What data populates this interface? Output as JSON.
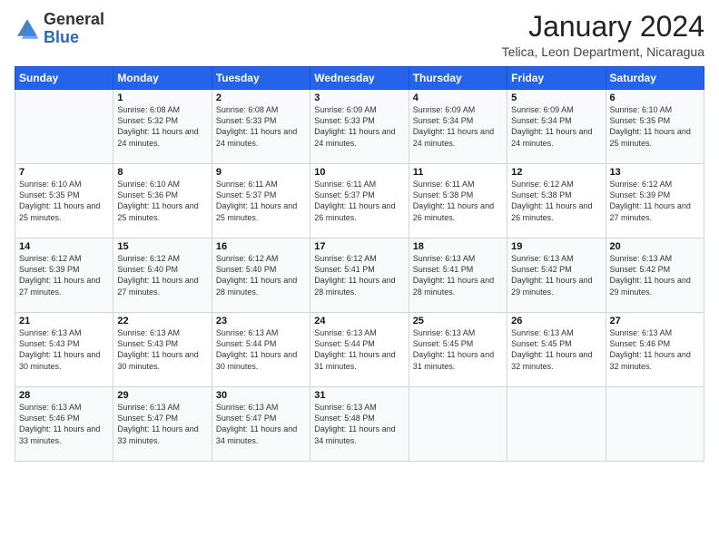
{
  "logo": {
    "general": "General",
    "blue": "Blue"
  },
  "title": "January 2024",
  "location": "Telica, Leon Department, Nicaragua",
  "days_of_week": [
    "Sunday",
    "Monday",
    "Tuesday",
    "Wednesday",
    "Thursday",
    "Friday",
    "Saturday"
  ],
  "weeks": [
    [
      {
        "day": "",
        "sunrise": "",
        "sunset": "",
        "daylight": ""
      },
      {
        "day": "1",
        "sunrise": "Sunrise: 6:08 AM",
        "sunset": "Sunset: 5:32 PM",
        "daylight": "Daylight: 11 hours and 24 minutes."
      },
      {
        "day": "2",
        "sunrise": "Sunrise: 6:08 AM",
        "sunset": "Sunset: 5:33 PM",
        "daylight": "Daylight: 11 hours and 24 minutes."
      },
      {
        "day": "3",
        "sunrise": "Sunrise: 6:09 AM",
        "sunset": "Sunset: 5:33 PM",
        "daylight": "Daylight: 11 hours and 24 minutes."
      },
      {
        "day": "4",
        "sunrise": "Sunrise: 6:09 AM",
        "sunset": "Sunset: 5:34 PM",
        "daylight": "Daylight: 11 hours and 24 minutes."
      },
      {
        "day": "5",
        "sunrise": "Sunrise: 6:09 AM",
        "sunset": "Sunset: 5:34 PM",
        "daylight": "Daylight: 11 hours and 24 minutes."
      },
      {
        "day": "6",
        "sunrise": "Sunrise: 6:10 AM",
        "sunset": "Sunset: 5:35 PM",
        "daylight": "Daylight: 11 hours and 25 minutes."
      }
    ],
    [
      {
        "day": "7",
        "sunrise": "Sunrise: 6:10 AM",
        "sunset": "Sunset: 5:35 PM",
        "daylight": "Daylight: 11 hours and 25 minutes."
      },
      {
        "day": "8",
        "sunrise": "Sunrise: 6:10 AM",
        "sunset": "Sunset: 5:36 PM",
        "daylight": "Daylight: 11 hours and 25 minutes."
      },
      {
        "day": "9",
        "sunrise": "Sunrise: 6:11 AM",
        "sunset": "Sunset: 5:37 PM",
        "daylight": "Daylight: 11 hours and 25 minutes."
      },
      {
        "day": "10",
        "sunrise": "Sunrise: 6:11 AM",
        "sunset": "Sunset: 5:37 PM",
        "daylight": "Daylight: 11 hours and 26 minutes."
      },
      {
        "day": "11",
        "sunrise": "Sunrise: 6:11 AM",
        "sunset": "Sunset: 5:38 PM",
        "daylight": "Daylight: 11 hours and 26 minutes."
      },
      {
        "day": "12",
        "sunrise": "Sunrise: 6:12 AM",
        "sunset": "Sunset: 5:38 PM",
        "daylight": "Daylight: 11 hours and 26 minutes."
      },
      {
        "day": "13",
        "sunrise": "Sunrise: 6:12 AM",
        "sunset": "Sunset: 5:39 PM",
        "daylight": "Daylight: 11 hours and 27 minutes."
      }
    ],
    [
      {
        "day": "14",
        "sunrise": "Sunrise: 6:12 AM",
        "sunset": "Sunset: 5:39 PM",
        "daylight": "Daylight: 11 hours and 27 minutes."
      },
      {
        "day": "15",
        "sunrise": "Sunrise: 6:12 AM",
        "sunset": "Sunset: 5:40 PM",
        "daylight": "Daylight: 11 hours and 27 minutes."
      },
      {
        "day": "16",
        "sunrise": "Sunrise: 6:12 AM",
        "sunset": "Sunset: 5:40 PM",
        "daylight": "Daylight: 11 hours and 28 minutes."
      },
      {
        "day": "17",
        "sunrise": "Sunrise: 6:12 AM",
        "sunset": "Sunset: 5:41 PM",
        "daylight": "Daylight: 11 hours and 28 minutes."
      },
      {
        "day": "18",
        "sunrise": "Sunrise: 6:13 AM",
        "sunset": "Sunset: 5:41 PM",
        "daylight": "Daylight: 11 hours and 28 minutes."
      },
      {
        "day": "19",
        "sunrise": "Sunrise: 6:13 AM",
        "sunset": "Sunset: 5:42 PM",
        "daylight": "Daylight: 11 hours and 29 minutes."
      },
      {
        "day": "20",
        "sunrise": "Sunrise: 6:13 AM",
        "sunset": "Sunset: 5:42 PM",
        "daylight": "Daylight: 11 hours and 29 minutes."
      }
    ],
    [
      {
        "day": "21",
        "sunrise": "Sunrise: 6:13 AM",
        "sunset": "Sunset: 5:43 PM",
        "daylight": "Daylight: 11 hours and 30 minutes."
      },
      {
        "day": "22",
        "sunrise": "Sunrise: 6:13 AM",
        "sunset": "Sunset: 5:43 PM",
        "daylight": "Daylight: 11 hours and 30 minutes."
      },
      {
        "day": "23",
        "sunrise": "Sunrise: 6:13 AM",
        "sunset": "Sunset: 5:44 PM",
        "daylight": "Daylight: 11 hours and 30 minutes."
      },
      {
        "day": "24",
        "sunrise": "Sunrise: 6:13 AM",
        "sunset": "Sunset: 5:44 PM",
        "daylight": "Daylight: 11 hours and 31 minutes."
      },
      {
        "day": "25",
        "sunrise": "Sunrise: 6:13 AM",
        "sunset": "Sunset: 5:45 PM",
        "daylight": "Daylight: 11 hours and 31 minutes."
      },
      {
        "day": "26",
        "sunrise": "Sunrise: 6:13 AM",
        "sunset": "Sunset: 5:45 PM",
        "daylight": "Daylight: 11 hours and 32 minutes."
      },
      {
        "day": "27",
        "sunrise": "Sunrise: 6:13 AM",
        "sunset": "Sunset: 5:46 PM",
        "daylight": "Daylight: 11 hours and 32 minutes."
      }
    ],
    [
      {
        "day": "28",
        "sunrise": "Sunrise: 6:13 AM",
        "sunset": "Sunset: 5:46 PM",
        "daylight": "Daylight: 11 hours and 33 minutes."
      },
      {
        "day": "29",
        "sunrise": "Sunrise: 6:13 AM",
        "sunset": "Sunset: 5:47 PM",
        "daylight": "Daylight: 11 hours and 33 minutes."
      },
      {
        "day": "30",
        "sunrise": "Sunrise: 6:13 AM",
        "sunset": "Sunset: 5:47 PM",
        "daylight": "Daylight: 11 hours and 34 minutes."
      },
      {
        "day": "31",
        "sunrise": "Sunrise: 6:13 AM",
        "sunset": "Sunset: 5:48 PM",
        "daylight": "Daylight: 11 hours and 34 minutes."
      },
      {
        "day": "",
        "sunrise": "",
        "sunset": "",
        "daylight": ""
      },
      {
        "day": "",
        "sunrise": "",
        "sunset": "",
        "daylight": ""
      },
      {
        "day": "",
        "sunrise": "",
        "sunset": "",
        "daylight": ""
      }
    ]
  ]
}
